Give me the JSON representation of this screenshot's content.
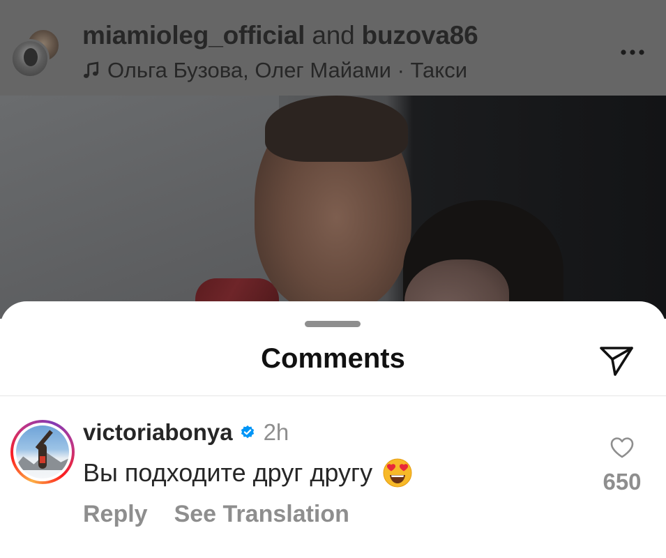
{
  "post": {
    "owner_primary": "miamioleg_official",
    "owner_join": "and",
    "owner_secondary": "buzova86",
    "music": "Ольга Бузова, Олег Майами · Такси",
    "music_icon": "music-note-icon",
    "more_icon": "more-horizontal-icon"
  },
  "comments_sheet": {
    "title": "Comments",
    "share_icon": "send-paper-plane-icon",
    "items": [
      {
        "username": "victoriabonya",
        "verified": true,
        "time": "2h",
        "text": "Вы подходите друг другу",
        "emoji": "😍",
        "reply_label": "Reply",
        "translate_label": "See Translation",
        "like_count": "650"
      }
    ]
  },
  "colors": {
    "dim_overlay": "#666666",
    "verified_blue": "#0095f6",
    "secondary_text": "#8e8e8e",
    "primary_text": "#262626"
  }
}
